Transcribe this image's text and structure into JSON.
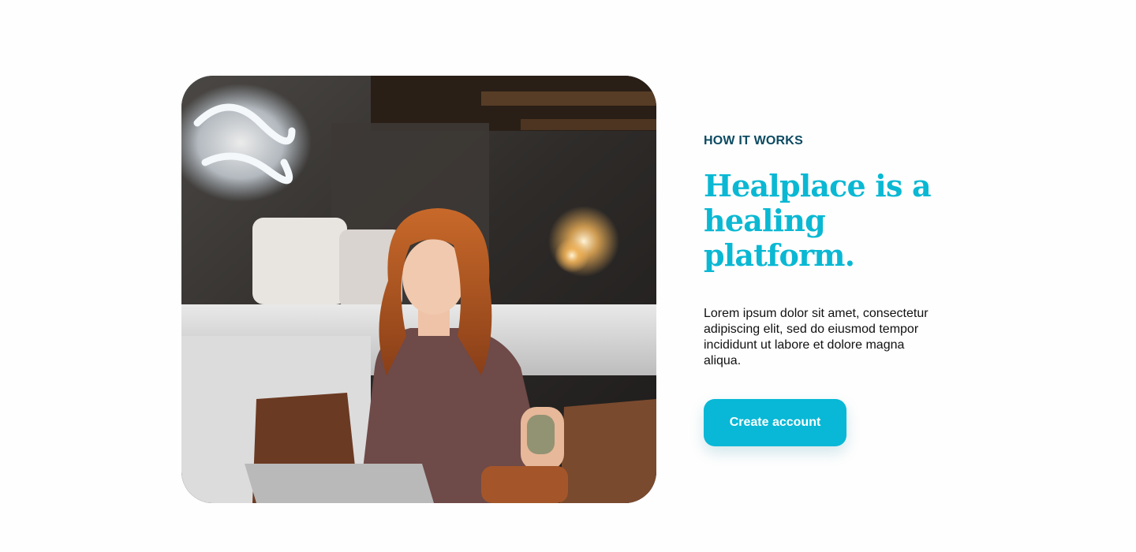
{
  "hero": {
    "image_alt": "Woman smiling at laptop in a cafe",
    "eyebrow": "HOW IT WORKS",
    "headline": "Healplace is a healing platform.",
    "body": "Lorem ipsum dolor sit amet, consectetur adipiscing elit, sed do eiusmod tempor incididunt ut labore et dolore magna aliqua.",
    "cta_label": "Create account"
  },
  "colors": {
    "accent": "#08b8d6",
    "eyebrow": "#0c4a62",
    "body_text": "#111111"
  }
}
